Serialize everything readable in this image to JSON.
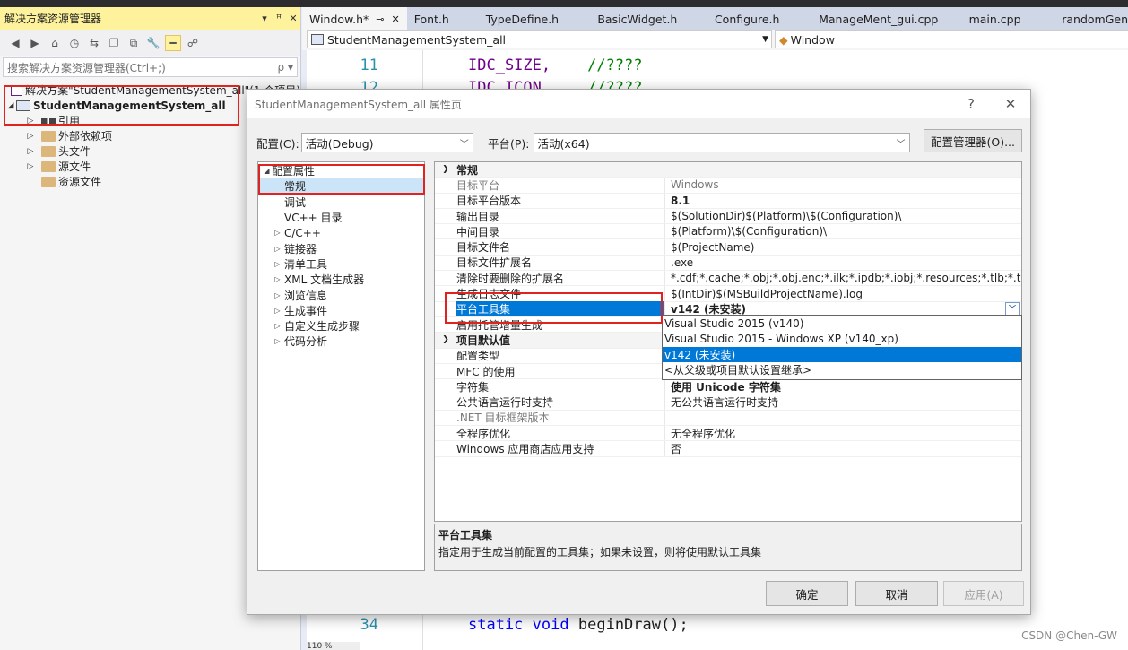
{
  "solution_explorer": {
    "title": "解决方案资源管理器",
    "title_buttons": [
      "▾",
      "ꟸ",
      "✕"
    ],
    "search_placeholder": "搜索解决方案资源管理器(Ctrl+;)",
    "search_icon": "ρ ▾",
    "solution_label": "解决方案\"StudentManagementSystem_all\"(1 个项目)",
    "project_label": "StudentManagementSystem_all",
    "nodes": [
      {
        "label": "引用",
        "icon": "reference-icon"
      },
      {
        "label": "外部依赖项",
        "icon": "folder-icon"
      },
      {
        "label": "头文件",
        "icon": "folder-icon"
      },
      {
        "label": "源文件",
        "icon": "folder-icon"
      },
      {
        "label": "资源文件",
        "icon": "folder-icon"
      }
    ]
  },
  "editor": {
    "tabs": [
      {
        "label": "Window.h*",
        "active": true
      },
      {
        "label": "Font.h"
      },
      {
        "label": "TypeDefine.h"
      },
      {
        "label": "BasicWidget.h"
      },
      {
        "label": "Configure.h"
      },
      {
        "label": "ManageMent_gui.cpp"
      },
      {
        "label": "main.cpp"
      },
      {
        "label": "randomGen"
      }
    ],
    "tab_pin": "⊸",
    "tab_close": "✕",
    "nav_scope": "StudentManagementSystem_all",
    "nav_member": "Window",
    "lines": {
      "l11": {
        "num": "11",
        "code": "IDC_SIZE,",
        "comment": "//????"
      },
      "l12": {
        "num": "12",
        "code": "IDC_ICON,",
        "comment": "//????"
      },
      "l34": {
        "num": "34",
        "kw1": "static",
        "kw2": "void",
        "rest": "beginDraw();"
      }
    },
    "zoom": "110 %"
  },
  "dialog": {
    "title": "StudentManagementSystem_all 属性页",
    "help": "?",
    "close": "✕",
    "config_label": "配置(C):",
    "config_value": "活动(Debug)",
    "platform_label": "平台(P):",
    "platform_value": "活动(x64)",
    "config_manager": "配置管理器(O)...",
    "nav": [
      {
        "label": "配置属性",
        "arrow": "◢",
        "indent": 0
      },
      {
        "label": "常规",
        "indent": 1,
        "selected": true
      },
      {
        "label": "调试",
        "indent": 1
      },
      {
        "label": "VC++ 目录",
        "indent": 1
      },
      {
        "label": "C/C++",
        "arrow": "▷",
        "indent": 1
      },
      {
        "label": "链接器",
        "arrow": "▷",
        "indent": 1
      },
      {
        "label": "清单工具",
        "arrow": "▷",
        "indent": 1
      },
      {
        "label": "XML 文档生成器",
        "arrow": "▷",
        "indent": 1
      },
      {
        "label": "浏览信息",
        "arrow": "▷",
        "indent": 1
      },
      {
        "label": "生成事件",
        "arrow": "▷",
        "indent": 1
      },
      {
        "label": "自定义生成步骤",
        "arrow": "▷",
        "indent": 1
      },
      {
        "label": "代码分析",
        "arrow": "▷",
        "indent": 1
      }
    ],
    "grid": {
      "cat1": "常规",
      "cat2": "项目默认值",
      "rows1": [
        {
          "name": "目标平台",
          "value": "Windows",
          "dim": true
        },
        {
          "name": "目标平台版本",
          "value": "8.1",
          "bold": true
        },
        {
          "name": "输出目录",
          "value": "$(SolutionDir)$(Platform)\\$(Configuration)\\"
        },
        {
          "name": "中间目录",
          "value": "$(Platform)\\$(Configuration)\\"
        },
        {
          "name": "目标文件名",
          "value": "$(ProjectName)"
        },
        {
          "name": "目标文件扩展名",
          "value": ".exe"
        },
        {
          "name": "清除时要删除的扩展名",
          "value": "*.cdf;*.cache;*.obj;*.obj.enc;*.ilk;*.ipdb;*.iobj;*.resources;*.tlb;*.tli;*.tlh;*.t"
        },
        {
          "name": "生成日志文件",
          "value": "$(IntDir)$(MSBuildProjectName).log"
        },
        {
          "name": "平台工具集",
          "value": "v142 (未安装)",
          "bold": true,
          "selected": true
        },
        {
          "name": "启用托管增量生成",
          "value": ""
        }
      ],
      "rows2": [
        {
          "name": "配置类型",
          "value": ""
        },
        {
          "name": "MFC 的使用",
          "value": ""
        },
        {
          "name": "字符集",
          "value": "使用 Unicode 字符集",
          "bold": true
        },
        {
          "name": "公共语言运行时支持",
          "value": "无公共语言运行时支持"
        },
        {
          "name": ".NET 目标框架版本",
          "value": "",
          "dimname": true
        },
        {
          "name": "全程序优化",
          "value": "无全程序优化"
        },
        {
          "name": "Windows 应用商店应用支持",
          "value": "否"
        }
      ]
    },
    "dropdown_options": [
      {
        "label": "Visual Studio 2015 (v140)"
      },
      {
        "label": "Visual Studio 2015 - Windows XP (v140_xp)"
      },
      {
        "label": "v142 (未安装)",
        "selected": true
      },
      {
        "label": "<从父级或项目默认设置继承>"
      }
    ],
    "description": {
      "title": "平台工具集",
      "text": "指定用于生成当前配置的工具集；如果未设置，则将使用默认工具集"
    },
    "buttons": {
      "ok": "确定",
      "cancel": "取消",
      "apply": "应用(A)"
    }
  },
  "watermark": "CSDN @Chen-GW",
  "colors": {
    "accent": "#0078d7",
    "annotation": "#e0231f",
    "explorer_header": "#fff29d"
  }
}
